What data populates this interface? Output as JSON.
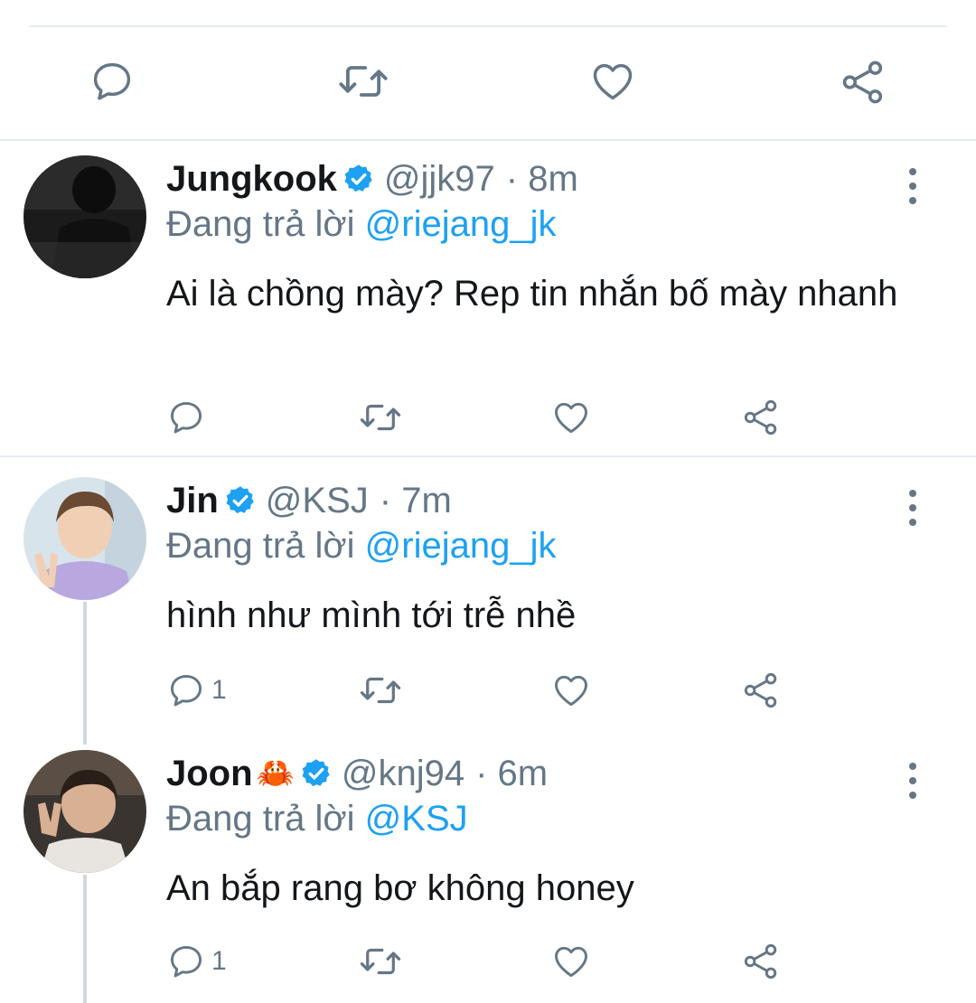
{
  "colors": {
    "accent": "#1da1f2",
    "muted": "#657786",
    "text": "#14171a",
    "divider": "#e6ecf0",
    "verified": "#1da1f2"
  },
  "top_actions": {
    "icons": [
      "reply-icon",
      "retweet-icon",
      "like-icon",
      "share-icon"
    ]
  },
  "tweets": [
    {
      "name": "Jungkook",
      "verified": true,
      "handle": "@jjk97",
      "time": "· 8m",
      "replying_prefix": "Đang trả lời",
      "replying_to": "@riejang_jk",
      "text": "Ai là chồng mày? Rep tin nhắn bố mày nhanh",
      "reply_count": "",
      "avatar": "avatar-dark-photo"
    },
    {
      "name": "Jin",
      "verified": true,
      "handle": "@KSJ",
      "time": "· 7m",
      "replying_prefix": "Đang trả lời",
      "replying_to": "@riejang_jk",
      "text": "hình như mình tới trễ nhề",
      "reply_count": "1",
      "avatar": "avatar-peace-sign-photo"
    },
    {
      "name": "Joon",
      "emoji": "🦀",
      "verified": true,
      "handle": "@knj94",
      "time": "· 6m",
      "replying_prefix": "Đang trả lời",
      "replying_to": "@KSJ",
      "text": "An bắp rang bơ không honey",
      "reply_count": "1",
      "avatar": "avatar-smiling-photo"
    }
  ]
}
